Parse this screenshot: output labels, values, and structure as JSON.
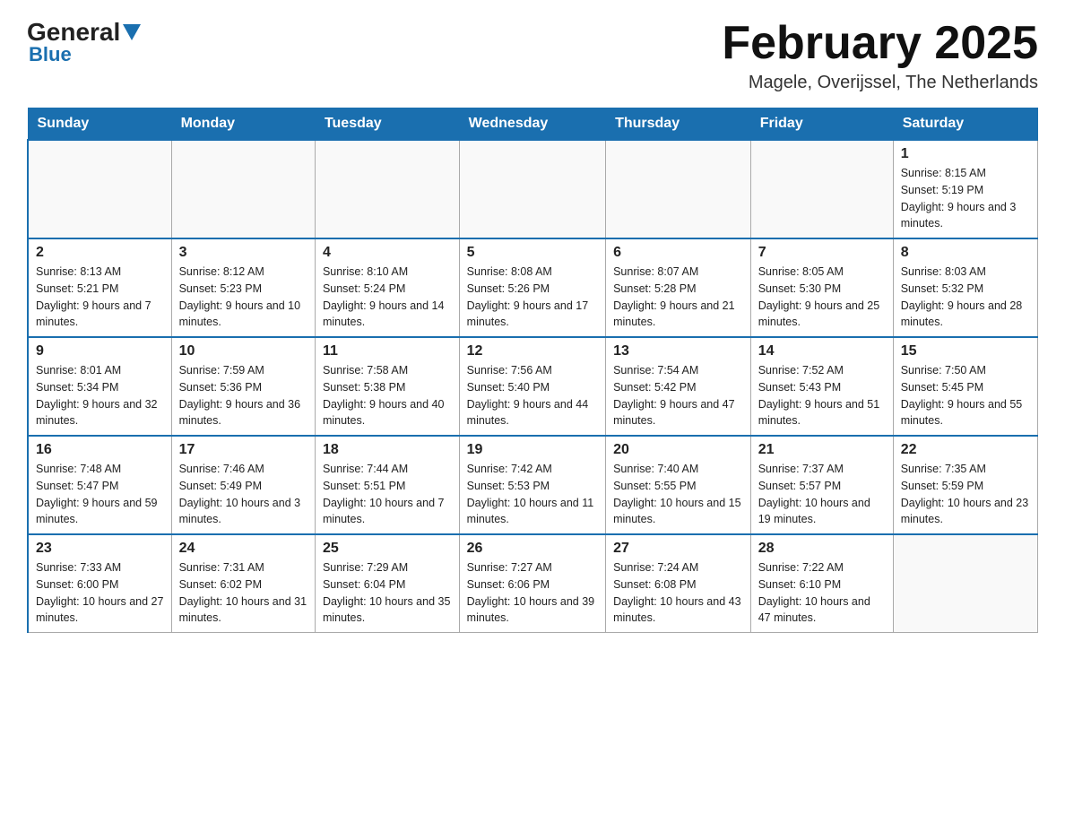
{
  "header": {
    "logo": {
      "general": "General",
      "blue": "Blue"
    },
    "title": "February 2025",
    "location": "Magele, Overijssel, The Netherlands"
  },
  "days_of_week": [
    "Sunday",
    "Monday",
    "Tuesday",
    "Wednesday",
    "Thursday",
    "Friday",
    "Saturday"
  ],
  "weeks": [
    [
      {
        "day": "",
        "info": ""
      },
      {
        "day": "",
        "info": ""
      },
      {
        "day": "",
        "info": ""
      },
      {
        "day": "",
        "info": ""
      },
      {
        "day": "",
        "info": ""
      },
      {
        "day": "",
        "info": ""
      },
      {
        "day": "1",
        "info": "Sunrise: 8:15 AM\nSunset: 5:19 PM\nDaylight: 9 hours and 3 minutes."
      }
    ],
    [
      {
        "day": "2",
        "info": "Sunrise: 8:13 AM\nSunset: 5:21 PM\nDaylight: 9 hours and 7 minutes."
      },
      {
        "day": "3",
        "info": "Sunrise: 8:12 AM\nSunset: 5:23 PM\nDaylight: 9 hours and 10 minutes."
      },
      {
        "day": "4",
        "info": "Sunrise: 8:10 AM\nSunset: 5:24 PM\nDaylight: 9 hours and 14 minutes."
      },
      {
        "day": "5",
        "info": "Sunrise: 8:08 AM\nSunset: 5:26 PM\nDaylight: 9 hours and 17 minutes."
      },
      {
        "day": "6",
        "info": "Sunrise: 8:07 AM\nSunset: 5:28 PM\nDaylight: 9 hours and 21 minutes."
      },
      {
        "day": "7",
        "info": "Sunrise: 8:05 AM\nSunset: 5:30 PM\nDaylight: 9 hours and 25 minutes."
      },
      {
        "day": "8",
        "info": "Sunrise: 8:03 AM\nSunset: 5:32 PM\nDaylight: 9 hours and 28 minutes."
      }
    ],
    [
      {
        "day": "9",
        "info": "Sunrise: 8:01 AM\nSunset: 5:34 PM\nDaylight: 9 hours and 32 minutes."
      },
      {
        "day": "10",
        "info": "Sunrise: 7:59 AM\nSunset: 5:36 PM\nDaylight: 9 hours and 36 minutes."
      },
      {
        "day": "11",
        "info": "Sunrise: 7:58 AM\nSunset: 5:38 PM\nDaylight: 9 hours and 40 minutes."
      },
      {
        "day": "12",
        "info": "Sunrise: 7:56 AM\nSunset: 5:40 PM\nDaylight: 9 hours and 44 minutes."
      },
      {
        "day": "13",
        "info": "Sunrise: 7:54 AM\nSunset: 5:42 PM\nDaylight: 9 hours and 47 minutes."
      },
      {
        "day": "14",
        "info": "Sunrise: 7:52 AM\nSunset: 5:43 PM\nDaylight: 9 hours and 51 minutes."
      },
      {
        "day": "15",
        "info": "Sunrise: 7:50 AM\nSunset: 5:45 PM\nDaylight: 9 hours and 55 minutes."
      }
    ],
    [
      {
        "day": "16",
        "info": "Sunrise: 7:48 AM\nSunset: 5:47 PM\nDaylight: 9 hours and 59 minutes."
      },
      {
        "day": "17",
        "info": "Sunrise: 7:46 AM\nSunset: 5:49 PM\nDaylight: 10 hours and 3 minutes."
      },
      {
        "day": "18",
        "info": "Sunrise: 7:44 AM\nSunset: 5:51 PM\nDaylight: 10 hours and 7 minutes."
      },
      {
        "day": "19",
        "info": "Sunrise: 7:42 AM\nSunset: 5:53 PM\nDaylight: 10 hours and 11 minutes."
      },
      {
        "day": "20",
        "info": "Sunrise: 7:40 AM\nSunset: 5:55 PM\nDaylight: 10 hours and 15 minutes."
      },
      {
        "day": "21",
        "info": "Sunrise: 7:37 AM\nSunset: 5:57 PM\nDaylight: 10 hours and 19 minutes."
      },
      {
        "day": "22",
        "info": "Sunrise: 7:35 AM\nSunset: 5:59 PM\nDaylight: 10 hours and 23 minutes."
      }
    ],
    [
      {
        "day": "23",
        "info": "Sunrise: 7:33 AM\nSunset: 6:00 PM\nDaylight: 10 hours and 27 minutes."
      },
      {
        "day": "24",
        "info": "Sunrise: 7:31 AM\nSunset: 6:02 PM\nDaylight: 10 hours and 31 minutes."
      },
      {
        "day": "25",
        "info": "Sunrise: 7:29 AM\nSunset: 6:04 PM\nDaylight: 10 hours and 35 minutes."
      },
      {
        "day": "26",
        "info": "Sunrise: 7:27 AM\nSunset: 6:06 PM\nDaylight: 10 hours and 39 minutes."
      },
      {
        "day": "27",
        "info": "Sunrise: 7:24 AM\nSunset: 6:08 PM\nDaylight: 10 hours and 43 minutes."
      },
      {
        "day": "28",
        "info": "Sunrise: 7:22 AM\nSunset: 6:10 PM\nDaylight: 10 hours and 47 minutes."
      },
      {
        "day": "",
        "info": ""
      }
    ]
  ]
}
